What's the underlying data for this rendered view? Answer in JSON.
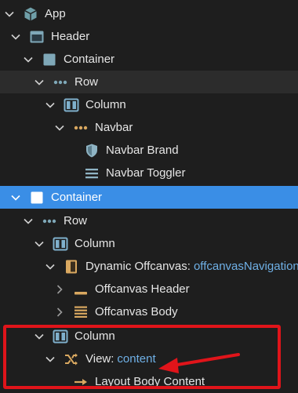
{
  "tree": {
    "app": "App",
    "header": "Header",
    "container1": "Container",
    "row1": "Row",
    "column1": "Column",
    "navbar": "Navbar",
    "navbar_brand": "Navbar Brand",
    "navbar_toggler": "Navbar Toggler",
    "container2": "Container",
    "row2": "Row",
    "column2": "Column",
    "dynamic_offcanvas": "Dynamic Offcanvas:",
    "dynamic_offcanvas_value": "offcanvasNavigation",
    "offcanvas_header": "Offcanvas Header",
    "offcanvas_body": "Offcanvas Body",
    "column3": "Column",
    "view": "View:",
    "view_value": "content",
    "layout_body_content": "Layout Body Content"
  },
  "colors": {
    "background": "#1e1e1e",
    "selected_row": "#3a8ee6",
    "hover_row": "#2c2c2c",
    "accent_text": "#6fb0e6",
    "annotation": "#e0141a"
  }
}
